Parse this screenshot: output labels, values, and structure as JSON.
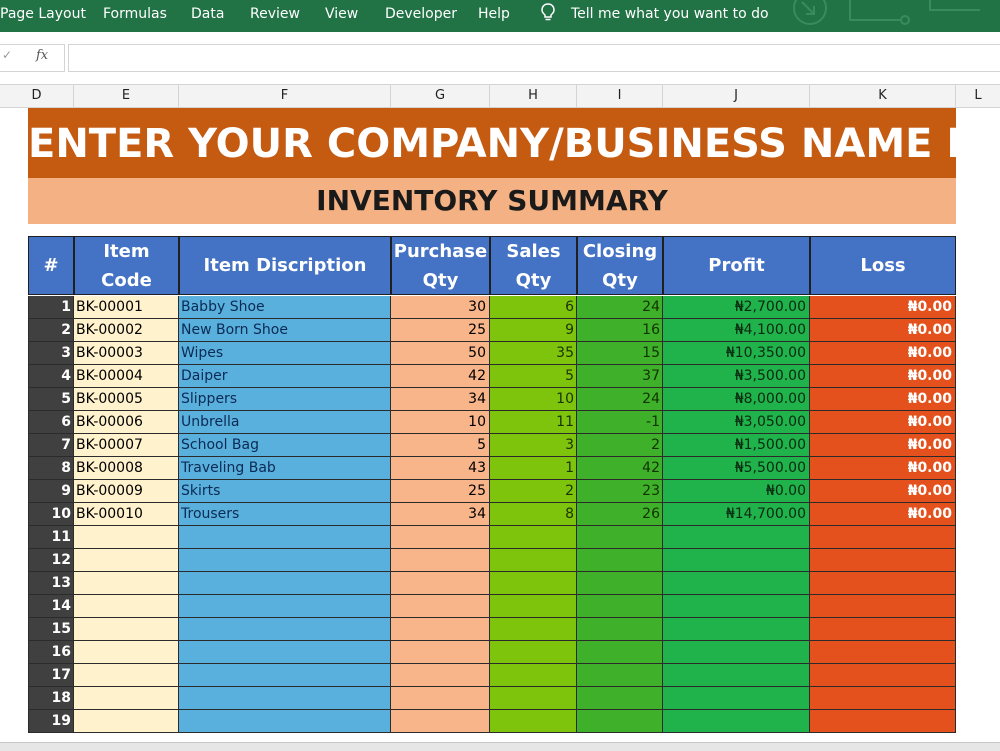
{
  "ribbon": {
    "tabs": [
      "Page Layout",
      "Formulas",
      "Data",
      "Review",
      "View",
      "Developer",
      "Help"
    ],
    "tell_me": "Tell me what you want to do"
  },
  "formula_bar": {
    "fx_label": "fx",
    "value": ""
  },
  "columns": [
    "D",
    "E",
    "F",
    "G",
    "H",
    "I",
    "J",
    "K",
    "L"
  ],
  "sheet": {
    "title": "ENTER YOUR COMPANY/BUSINESS NAME HERE",
    "subtitle": "INVENTORY SUMMARY",
    "headers": {
      "num": "#",
      "code": "Item Code",
      "desc": "Item Discription",
      "purchase": "Purchase Qty",
      "sales": "Sales Qty",
      "closing": "Closing Qty",
      "profit": "Profit",
      "loss": "Loss"
    },
    "rows": [
      {
        "num": "1",
        "code": "BK-00001",
        "desc": "Babby Shoe",
        "purchase": "30",
        "sales": "6",
        "closing": "24",
        "profit": "₦2,700.00",
        "loss": "₦0.00"
      },
      {
        "num": "2",
        "code": "BK-00002",
        "desc": "New Born Shoe",
        "purchase": "25",
        "sales": "9",
        "closing": "16",
        "profit": "₦4,100.00",
        "loss": "₦0.00"
      },
      {
        "num": "3",
        "code": "BK-00003",
        "desc": "Wipes",
        "purchase": "50",
        "sales": "35",
        "closing": "15",
        "profit": "₦10,350.00",
        "loss": "₦0.00"
      },
      {
        "num": "4",
        "code": "BK-00004",
        "desc": "Daiper",
        "purchase": "42",
        "sales": "5",
        "closing": "37",
        "profit": "₦3,500.00",
        "loss": "₦0.00"
      },
      {
        "num": "5",
        "code": "BK-00005",
        "desc": "Slippers",
        "purchase": "34",
        "sales": "10",
        "closing": "24",
        "profit": "₦8,000.00",
        "loss": "₦0.00"
      },
      {
        "num": "6",
        "code": "BK-00006",
        "desc": "Unbrella",
        "purchase": "10",
        "sales": "11",
        "closing": "-1",
        "profit": "₦3,050.00",
        "loss": "₦0.00"
      },
      {
        "num": "7",
        "code": "BK-00007",
        "desc": "School Bag",
        "purchase": "5",
        "sales": "3",
        "closing": "2",
        "profit": "₦1,500.00",
        "loss": "₦0.00"
      },
      {
        "num": "8",
        "code": "BK-00008",
        "desc": "Traveling Bab",
        "purchase": "43",
        "sales": "1",
        "closing": "42",
        "profit": "₦5,500.00",
        "loss": "₦0.00"
      },
      {
        "num": "9",
        "code": "BK-00009",
        "desc": "Skirts",
        "purchase": "25",
        "sales": "2",
        "closing": "23",
        "profit": "₦0.00",
        "loss": "₦0.00"
      },
      {
        "num": "10",
        "code": "BK-00010",
        "desc": "Trousers",
        "purchase": "34",
        "sales": "8",
        "closing": "26",
        "profit": "₦14,700.00",
        "loss": "₦0.00"
      },
      {
        "num": "11",
        "code": "",
        "desc": "",
        "purchase": "",
        "sales": "",
        "closing": "",
        "profit": "",
        "loss": ""
      },
      {
        "num": "12",
        "code": "",
        "desc": "",
        "purchase": "",
        "sales": "",
        "closing": "",
        "profit": "",
        "loss": ""
      },
      {
        "num": "13",
        "code": "",
        "desc": "",
        "purchase": "",
        "sales": "",
        "closing": "",
        "profit": "",
        "loss": ""
      },
      {
        "num": "14",
        "code": "",
        "desc": "",
        "purchase": "",
        "sales": "",
        "closing": "",
        "profit": "",
        "loss": ""
      },
      {
        "num": "15",
        "code": "",
        "desc": "",
        "purchase": "",
        "sales": "",
        "closing": "",
        "profit": "",
        "loss": ""
      },
      {
        "num": "16",
        "code": "",
        "desc": "",
        "purchase": "",
        "sales": "",
        "closing": "",
        "profit": "",
        "loss": ""
      },
      {
        "num": "17",
        "code": "",
        "desc": "",
        "purchase": "",
        "sales": "",
        "closing": "",
        "profit": "",
        "loss": ""
      },
      {
        "num": "18",
        "code": "",
        "desc": "",
        "purchase": "",
        "sales": "",
        "closing": "",
        "profit": "",
        "loss": ""
      },
      {
        "num": "19",
        "code": "",
        "desc": "",
        "purchase": "",
        "sales": "",
        "closing": "",
        "profit": "",
        "loss": ""
      }
    ]
  }
}
